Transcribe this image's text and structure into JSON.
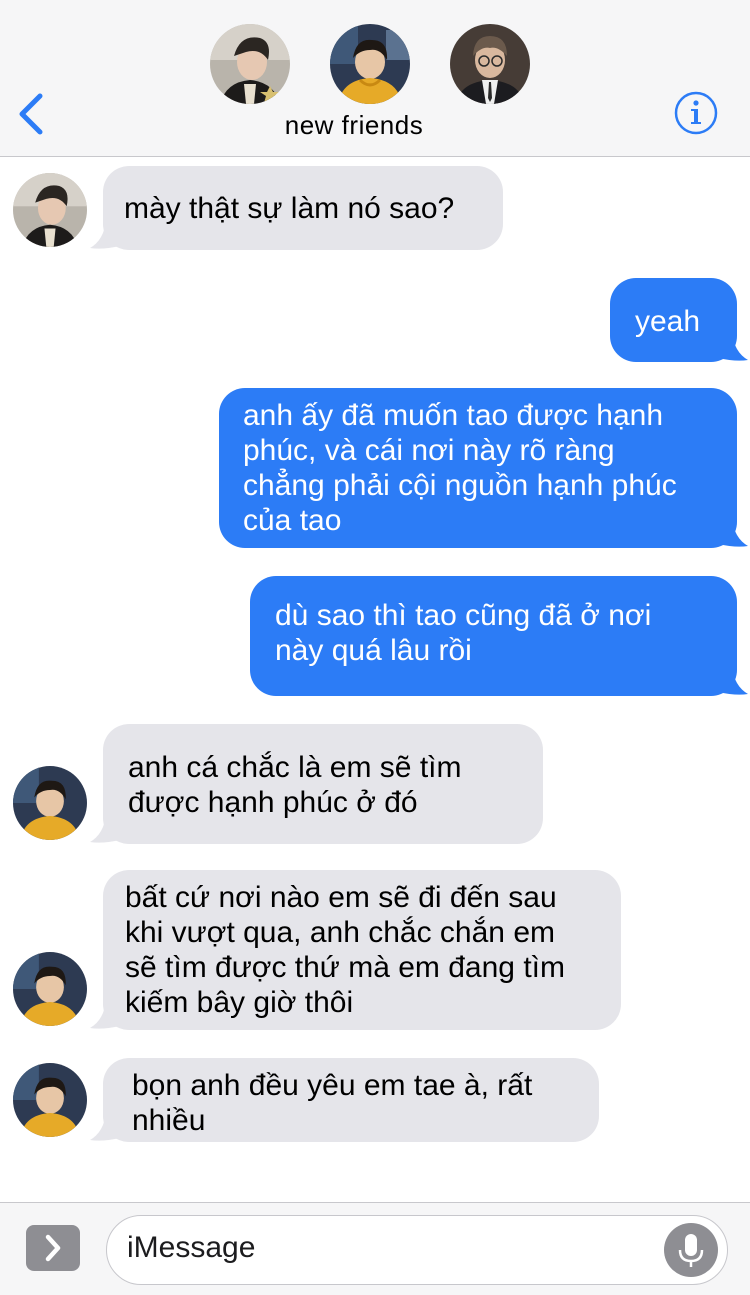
{
  "header": {
    "group_name": "new friends",
    "participants": [
      "participant-1-avatar",
      "participant-2-avatar",
      "participant-3-avatar"
    ],
    "back_icon": "chevron-left-icon",
    "info_icon": "info-icon",
    "accent_color": "#2c7cf6"
  },
  "messages": [
    {
      "direction": "incoming",
      "avatar": "avatar-1",
      "text": "mày thật sự làm nó sao?"
    },
    {
      "direction": "outgoing",
      "text": "yeah"
    },
    {
      "direction": "outgoing",
      "text": "anh ấy đã muốn tao được hạnh\nphúc, và cái nơi này rõ ràng\nchẳng phải cội nguồn hạnh phúc\ncủa tao"
    },
    {
      "direction": "outgoing",
      "text": "dù sao thì tao cũng đã ở nơi\nnày quá lâu rồi"
    },
    {
      "direction": "incoming",
      "avatar": "avatar-2",
      "text": "anh cá chắc là em sẽ tìm\nđược hạnh phúc ở đó"
    },
    {
      "direction": "incoming",
      "avatar": "avatar-2",
      "text": "bất cứ nơi nào em sẽ đi đến sau\nkhi vượt qua, anh chắc chắn em\nsẽ tìm được thứ mà em đang tìm\nkiếm bây giờ thôi"
    },
    {
      "direction": "incoming",
      "avatar": "avatar-2",
      "text": "bọn anh đều yêu em tae à, rất\nnhiều"
    }
  ],
  "composer": {
    "placeholder": "iMessage",
    "apps_icon": "chevron-right-icon",
    "mic_icon": "microphone-icon"
  },
  "colors": {
    "incoming_bubble": "#e5e5ea",
    "outgoing_bubble": "#2c7cf6"
  }
}
